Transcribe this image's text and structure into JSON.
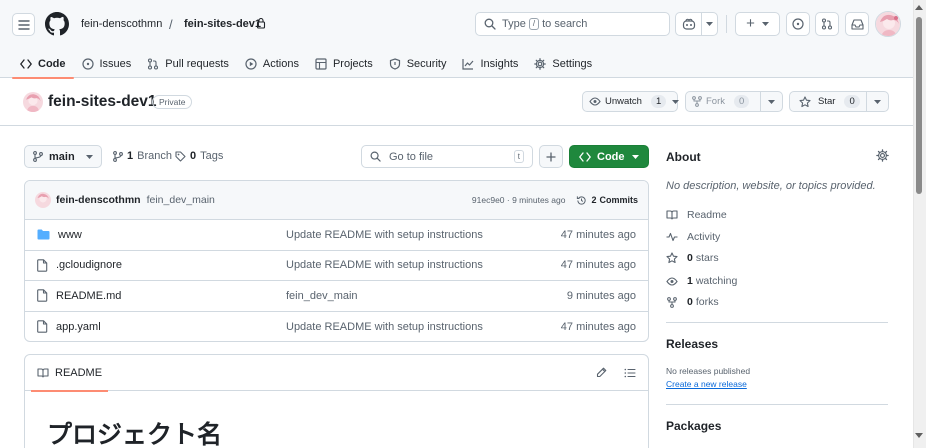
{
  "header": {
    "owner": "fein-denscothmn",
    "separator": "/",
    "repo": "fein-sites-dev1",
    "search": {
      "prefix": "Type",
      "key": "/",
      "suffix": "to search"
    },
    "new_label": "+"
  },
  "tabs": [
    {
      "label": "Code",
      "icon": "code-icon"
    },
    {
      "label": "Issues",
      "icon": "issue-icon"
    },
    {
      "label": "Pull requests",
      "icon": "pull-request-icon"
    },
    {
      "label": "Actions",
      "icon": "play-icon"
    },
    {
      "label": "Projects",
      "icon": "table-icon"
    },
    {
      "label": "Security",
      "icon": "shield-icon"
    },
    {
      "label": "Insights",
      "icon": "graph-icon"
    },
    {
      "label": "Settings",
      "icon": "gear-icon"
    }
  ],
  "repo": {
    "name": "fein-sites-dev1",
    "visibility": "Private",
    "watch_label": "Unwatch",
    "watch_count": "1",
    "fork_label": "Fork",
    "fork_count": "0",
    "star_label": "Star",
    "star_count": "0"
  },
  "toolbar": {
    "branch": "main",
    "branch_count": "1",
    "branch_label": "Branch",
    "tag_count": "0",
    "tag_label": "Tags",
    "goto_placeholder": "Go to file",
    "goto_key": "t",
    "code_label": "Code"
  },
  "commit": {
    "author": "fein-denscothmn",
    "message": "fein_dev_main",
    "hash_time": "91ec9e0 · 9 minutes ago",
    "commits_count": "2",
    "commits_label": "Commits"
  },
  "files": [
    {
      "type": "dir",
      "name": "www",
      "message": "Update README with setup instructions",
      "time": "47 minutes ago"
    },
    {
      "type": "file",
      "name": ".gcloudignore",
      "message": "Update README with setup instructions",
      "time": "47 minutes ago"
    },
    {
      "type": "file",
      "name": "README.md",
      "message": "fein_dev_main",
      "time": "9 minutes ago"
    },
    {
      "type": "file",
      "name": "app.yaml",
      "message": "Update README with setup instructions",
      "time": "47 minutes ago"
    }
  ],
  "readme": {
    "tab_label": "README",
    "heading": "プロジェクト名"
  },
  "sidebar": {
    "about_title": "About",
    "description": "No description, website, or topics provided.",
    "links": [
      {
        "icon": "book-icon",
        "count": "",
        "label": "Readme"
      },
      {
        "icon": "pulse-icon",
        "count": "",
        "label": "Activity"
      },
      {
        "icon": "star-icon",
        "count": "0",
        "label": "stars"
      },
      {
        "icon": "eye-icon",
        "count": "1",
        "label": "watching"
      },
      {
        "icon": "fork-icon",
        "count": "0",
        "label": "forks"
      }
    ],
    "releases_title": "Releases",
    "no_releases": "No releases published",
    "create_release": "Create a new release",
    "packages_title": "Packages"
  },
  "colors": {
    "accent_underline": "#fd8c73",
    "code_button": "#1f883d",
    "link": "#0969da",
    "folder": "#54aeff"
  }
}
